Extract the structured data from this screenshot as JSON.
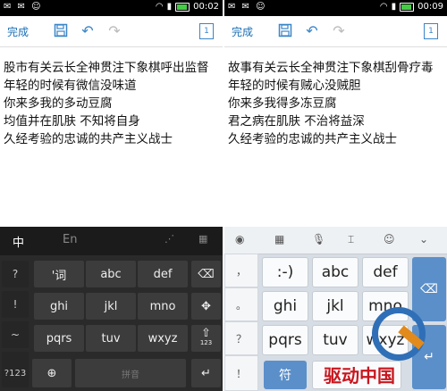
{
  "left": {
    "status": {
      "time": "00:02",
      "notif": "✉ ✉ ☺"
    },
    "toolbar": {
      "done": "完成",
      "page_num": "1"
    },
    "lines": [
      "股市有关云长全神贯注下象棋呼出监督",
      "年轻的时候有微信没味道",
      "你来多我的多动豆腐",
      "均值并在肌肤  不知将自身",
      "久经考验的忠诚的共产主义战士"
    ],
    "keyboard": {
      "tab_cn": "中",
      "tab_en": "En",
      "left_col": [
        "?",
        "!",
        "~",
        "…"
      ],
      "row1": [
        "'词",
        "abc",
        "def"
      ],
      "row2": [
        "ghi",
        "jkl",
        "mno"
      ],
      "row3": [
        "pqrs",
        "tuv",
        "wxyz"
      ],
      "k123": "?123",
      "globe": "⊕",
      "space": "拼音",
      "enter": "↵",
      "backspace": "⌫",
      "cursor": "✥",
      "shift": "⇧",
      "shift_sub": "123"
    }
  },
  "right": {
    "status": {
      "time": "00:09",
      "notif": "✉ ✉ ☺"
    },
    "toolbar": {
      "done": "完成",
      "page_num": "1"
    },
    "lines": [
      "故事有关云长全神贯注下象棋刮骨疗毒",
      "年轻的时候有贼心没贼胆",
      "你来多我得多冻豆腐",
      "君之病在肌肤  不治将益深",
      "久经考验的忠诚的共产主义战士"
    ],
    "keyboard": {
      "left_col": [
        "，",
        "。",
        "？",
        "！"
      ],
      "row1": [
        ":-)",
        "abc",
        "def"
      ],
      "row2": [
        "ghi",
        "jkl",
        "mno"
      ],
      "row3": [
        "pqrs",
        "tuv",
        "wxyz"
      ],
      "bottom": "符"
    }
  },
  "watermark": {
    "text": "驱动中国"
  }
}
